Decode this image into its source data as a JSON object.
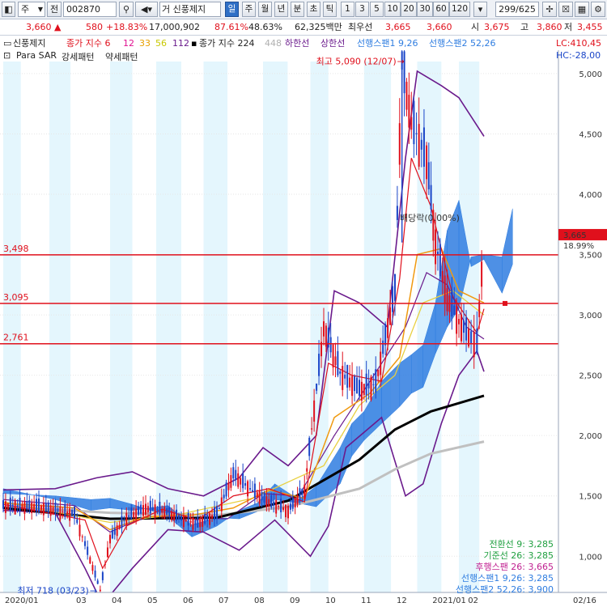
{
  "toolbar": {
    "market_type": "주",
    "prev_label": "전",
    "stock_code": "002870",
    "exchange_label": "거",
    "stock_name": "신풍제지",
    "periods": [
      "일",
      "주",
      "월",
      "년",
      "분",
      "초",
      "틱"
    ],
    "active_period": "일",
    "minute_options": [
      "1",
      "3",
      "5",
      "10",
      "20",
      "30",
      "60",
      "120"
    ],
    "count_display": "299/625",
    "search_icon": "search-icon",
    "settings_icon": "gear-icon"
  },
  "quote": {
    "price": "3,660",
    "change": "580",
    "change_pct": "+18.83%",
    "volume": "17,000,902",
    "ratio_1": "87.61%",
    "ratio_2": "48.63%",
    "trade_value": "62,325백만",
    "ref_label": "최우선",
    "ask": "3,665",
    "bid": "3,660",
    "low_label": "시",
    "open": "3,675",
    "high_label": "고",
    "high": "3,860",
    "low_label2": "저",
    "low": "3,455"
  },
  "legend": {
    "name": "신풍제지",
    "ma_label": "종가 지수 6",
    "ma12": "12",
    "ma33": "33",
    "ma56": "56",
    "ma112": "112",
    "ma224_label": "종가 지수 224",
    "ma448": "448",
    "lower_limit": "하한선",
    "upper_limit": "상한선",
    "span1": "선행스팬1 9,26",
    "span2": "선행스팬2 52,26",
    "lc": "LC:410,45",
    "hc": "HC:-28,00",
    "para_sar": "Para SAR",
    "strong": "강세패턴",
    "weak": "약세패턴"
  },
  "annotations": {
    "high_label": "최고 5,090 (12/07)",
    "low_label": "최저 718 (03/23)",
    "ex_dividend": "배당락(0.00%)",
    "current_price": "3,665",
    "current_pct": "18.99%"
  },
  "hlines": [
    {
      "label": "3,498",
      "value": 3498
    },
    {
      "label": "3,095",
      "value": 3095
    },
    {
      "label": "2,761",
      "value": 2761
    }
  ],
  "ichimoku": {
    "conversion": "전환선 9: 3,285",
    "base": "기준선 26: 3,285",
    "lagging": "후행스팬 26: 3,665",
    "span1": "선행스팬1 9,26: 3,285",
    "span2": "선행스팬2 52,26: 3,900"
  },
  "colors": {
    "up": "#e0101c",
    "down": "#1a45c8",
    "cloud": "#2f7de0",
    "bollinger": "#6a1a8c",
    "ma_long": "#000000",
    "ma_longer": "#c0c0c0"
  },
  "chart_data": {
    "type": "line",
    "title": "신풍제지",
    "ylim": [
      700,
      5100
    ],
    "y_ticks": [
      "1,000",
      "1,500",
      "2,000",
      "2,500",
      "3,000",
      "3,500",
      "4,000",
      "4,500",
      "5,000"
    ],
    "x_ticks": [
      "2020/01",
      "03",
      "04",
      "05",
      "06",
      "07",
      "08",
      "09",
      "10",
      "11",
      "12",
      "2021/01",
      "02",
      "02/16"
    ],
    "series": [
      {
        "name": "종가",
        "points": [
          [
            "2020/01",
            1420
          ],
          [
            "2020/02",
            1410
          ],
          [
            "2020/03/01",
            1350
          ],
          [
            "2020/03/10",
            1100
          ],
          [
            "2020/03/23",
            718
          ],
          [
            "2020/04/01",
            1150
          ],
          [
            "2020/04/15",
            1320
          ],
          [
            "2020/05/01",
            1400
          ],
          [
            "2020/05/15",
            1380
          ],
          [
            "2020/06/01",
            1310
          ],
          [
            "2020/06/15",
            1270
          ],
          [
            "2020/07/01",
            1350
          ],
          [
            "2020/07/15",
            1680
          ],
          [
            "2020/08/01",
            1540
          ],
          [
            "2020/08/15",
            1450
          ],
          [
            "2020/09/01",
            1380
          ],
          [
            "2020/09/15",
            1550
          ],
          [
            "2020/10/01",
            2900
          ],
          [
            "2020/10/15",
            2520
          ],
          [
            "2020/11/01",
            2380
          ],
          [
            "2020/11/15",
            2430
          ],
          [
            "2020/12/01",
            3200
          ],
          [
            "2020/12/07",
            5090
          ],
          [
            "2020/12/15",
            4600
          ],
          [
            "2020/12/28",
            4300
          ],
          [
            "2021/01/05",
            3600
          ],
          [
            "2021/01/15",
            3150
          ],
          [
            "2021/01/25",
            2950
          ],
          [
            "2021/02/05",
            2800
          ],
          [
            "2021/02/10",
            2761
          ],
          [
            "2021/02/16",
            3665
          ]
        ]
      },
      {
        "name": "종가 지수 224",
        "points": [
          [
            "2020/01",
            1400
          ],
          [
            "2020/04",
            1310
          ],
          [
            "2020/07",
            1320
          ],
          [
            "2020/09",
            1460
          ],
          [
            "2020/11",
            1800
          ],
          [
            "2020/12",
            2050
          ],
          [
            "2021/01",
            2200
          ],
          [
            "2021/02/16",
            2330
          ]
        ]
      },
      {
        "name": "종가 지수 448",
        "points": [
          [
            "2020/01",
            1410
          ],
          [
            "2020/04",
            1360
          ],
          [
            "2020/07",
            1340
          ],
          [
            "2020/09",
            1410
          ],
          [
            "2020/11",
            1560
          ],
          [
            "2020/12",
            1720
          ],
          [
            "2021/01",
            1850
          ],
          [
            "2021/02/16",
            1950
          ]
        ]
      }
    ]
  }
}
